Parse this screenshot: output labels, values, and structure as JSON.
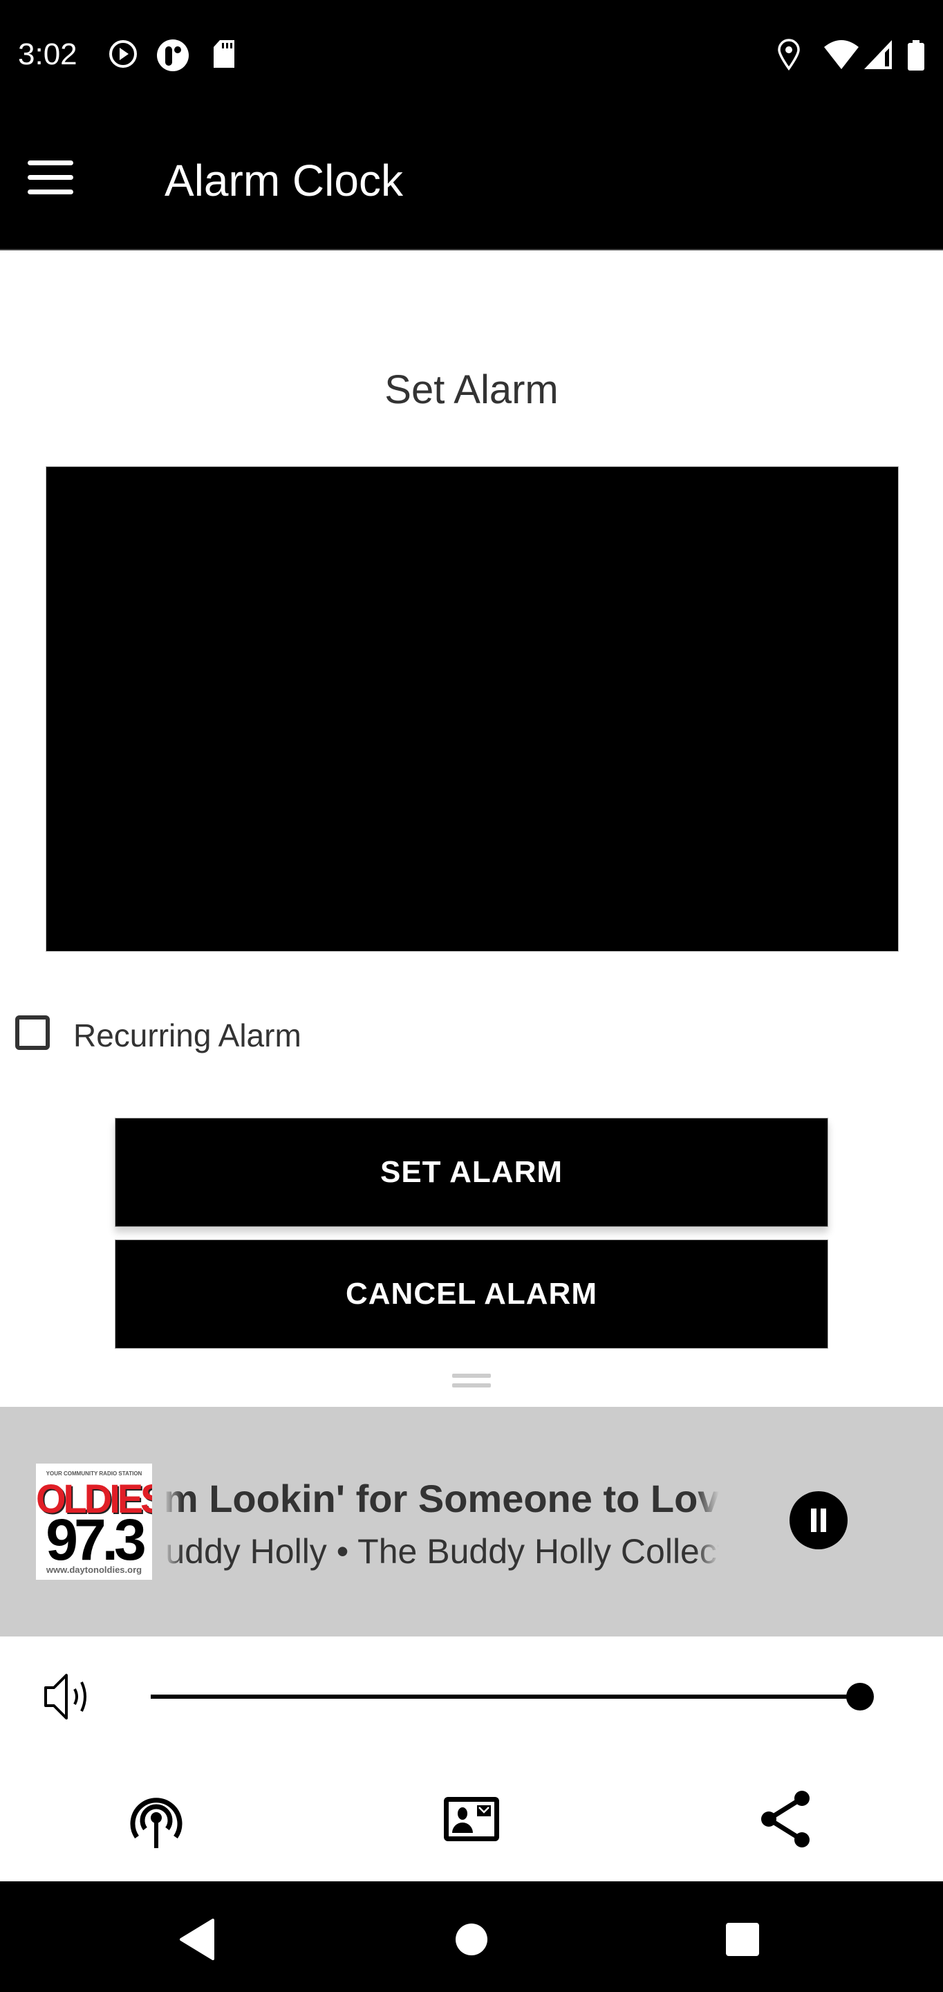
{
  "status_bar": {
    "time": "3:02",
    "left_icons": [
      "play-circle-icon",
      "app-notification-icon",
      "sd-card-icon"
    ],
    "right_icons": [
      "location-icon",
      "wifi-icon",
      "cell-signal-icon",
      "battery-icon"
    ]
  },
  "app_bar": {
    "title": "Alarm Clock",
    "menu_icon": "hamburger-menu-icon"
  },
  "main": {
    "section_title": "Set Alarm",
    "recurring_label": "Recurring Alarm",
    "recurring_checked": false,
    "set_alarm_label": "SET ALARM",
    "cancel_alarm_label": "CANCEL ALARM"
  },
  "player": {
    "logo": {
      "tagline": "YOUR COMMUNITY RADIO STATION",
      "name": "OLDIES",
      "frequency": "97.3",
      "url": "www.daytonoldies.org"
    },
    "track_title": "I'm Lookin' for Someone to Love",
    "track_subtitle": "Buddy Holly • The Buddy Holly Collection",
    "state": "playing",
    "control_icon": "pause-icon"
  },
  "volume": {
    "icon": "volume-icon",
    "level": 1.0
  },
  "toolbar": {
    "items": [
      {
        "icon": "podcast-broadcast-icon"
      },
      {
        "icon": "contact-card-icon"
      },
      {
        "icon": "share-icon"
      }
    ]
  },
  "nav_bar": {
    "items": [
      "back-icon",
      "home-icon",
      "recents-icon"
    ]
  },
  "colors": {
    "bar_background": "#000000",
    "player_background": "#cccccc",
    "logo_red": "#e01e26",
    "text_dark": "#333333"
  }
}
